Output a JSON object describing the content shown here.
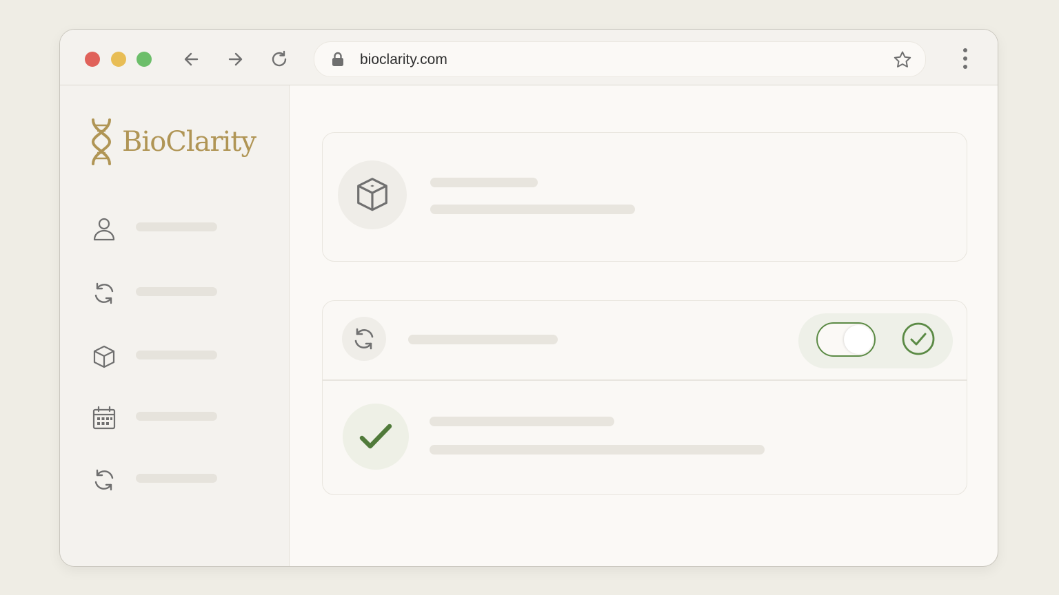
{
  "browser": {
    "url": "bioclarity.com",
    "traffic_lights": {
      "close": "#e0625a",
      "minimize": "#e8bd55",
      "maximize": "#6cbe6a"
    }
  },
  "brand": {
    "name": "BioClarity",
    "color": "#b09555"
  },
  "sidebar": {
    "items": [
      {
        "icon": "user-icon"
      },
      {
        "icon": "refresh-icon"
      },
      {
        "icon": "cube-icon"
      },
      {
        "icon": "calendar-icon"
      },
      {
        "icon": "refresh-icon"
      }
    ]
  },
  "main": {
    "product_card": {
      "icon": "cube-icon"
    },
    "sync_card": {
      "icon": "refresh-icon",
      "toggle_on": true,
      "status_icon": "check-circle-icon",
      "accent": "#5b8a45"
    },
    "confirm_row": {
      "icon": "checkmark-icon",
      "accent": "#5b8a45"
    }
  }
}
